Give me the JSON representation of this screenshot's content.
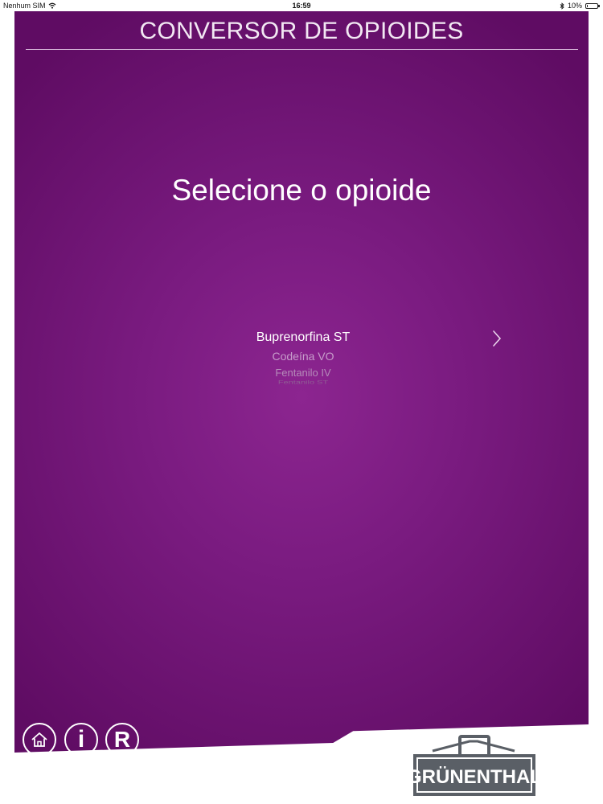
{
  "status_bar": {
    "carrier": "Nenhum SIM",
    "time": "16:59",
    "battery": "10%",
    "battery_level": 0.1
  },
  "header": {
    "title": "CONVERSOR DE OPIOIDES"
  },
  "main": {
    "prompt": "Selecione o opioide",
    "picker": {
      "items": [
        "Buprenorfina ST",
        "Codeína VO",
        "Fentanilo IV",
        "Fentanilo ST"
      ],
      "selected_index": 0
    }
  },
  "footer": {
    "nav": [
      {
        "icon": "home-icon"
      },
      {
        "icon": "info-icon",
        "label": "i"
      },
      {
        "icon": "references-icon",
        "label": "R"
      }
    ],
    "logo_text": "GRÜNENTHAL"
  },
  "colors": {
    "panel_center": "#8c2590",
    "panel_edge": "#5f0c63",
    "text": "#ffffff",
    "logo": "#5a5f66"
  }
}
